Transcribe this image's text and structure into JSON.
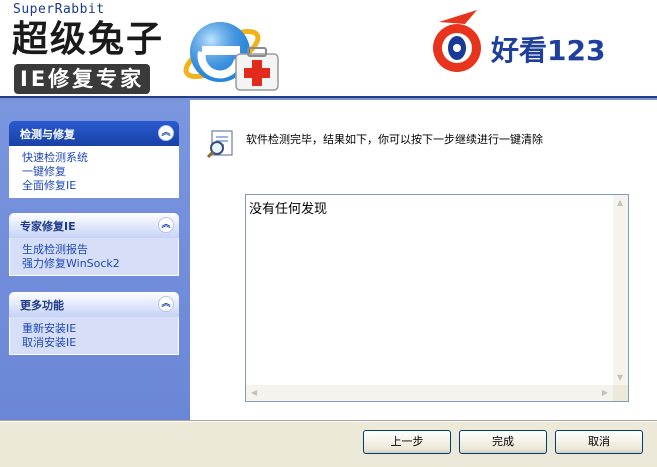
{
  "header": {
    "brand_small": "SuperRabbit",
    "brand_name": "超级兔子",
    "brand_product": "IE修复专家",
    "partner_logo_text": "好看123"
  },
  "sidebar": {
    "panels": [
      {
        "title": "检测与修复",
        "links": [
          "快速检测系统",
          "一键修复",
          "全面修复IE"
        ]
      },
      {
        "title": "专家修复IE",
        "links": [
          "生成检测报告",
          "强力修复WinSock2"
        ]
      },
      {
        "title": "更多功能",
        "links": [
          "重新安装IE",
          "取消安装IE"
        ]
      }
    ]
  },
  "main": {
    "message": "软件检测完毕，结果如下，你可以按下一步继续进行一键清除",
    "result": "没有任何发现"
  },
  "buttons": {
    "back": "上一步",
    "finish": "完成",
    "cancel": "取消"
  },
  "colors": {
    "sidebar_bg": "#7a96df",
    "panel_head_active": "#2a5bd0",
    "link": "#1d48b8",
    "header_rule": "#1f3f8c"
  },
  "icons": [
    "ie-repair-logo-icon",
    "haokan123-logo-icon",
    "magnifier-report-icon",
    "chevron-up-icon"
  ]
}
